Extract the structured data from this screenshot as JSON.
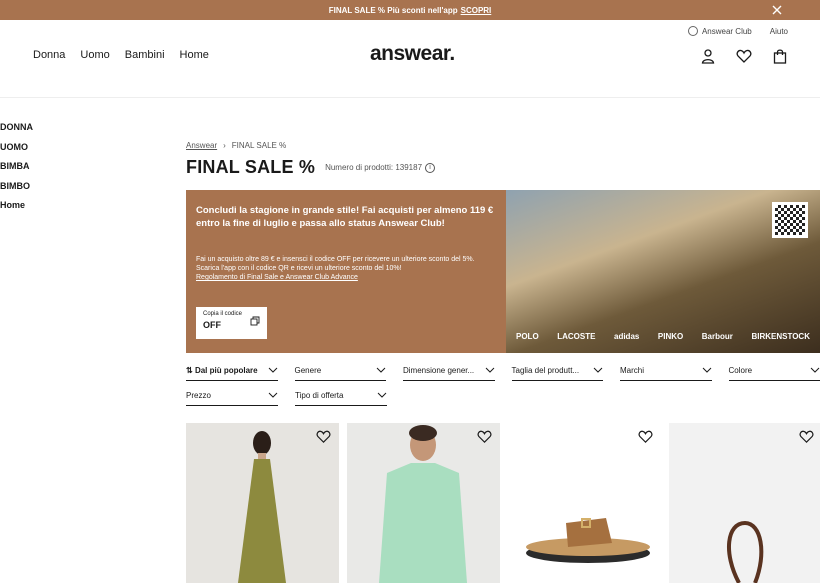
{
  "topbar": {
    "text": "FINAL SALE % Più sconti nell'app",
    "cta": "SCOPRI"
  },
  "header": {
    "util": {
      "club": "Answear Club",
      "help": "Aiuto"
    },
    "nav": [
      "Donna",
      "Uomo",
      "Bambini",
      "Home"
    ],
    "logo": "answear."
  },
  "sidebar": [
    "DONNA",
    "UOMO",
    "BIMBA",
    "BIMBO",
    "Home"
  ],
  "breadcrumb": {
    "home": "Answear",
    "sep": "›",
    "current": "FINAL SALE %"
  },
  "page": {
    "title": "FINAL SALE %",
    "count": "Numero di prodotti: 139187",
    "info": "i"
  },
  "banner": {
    "headline": "Concludi la stagione in grande stile! Fai acquisti per almeno 119 € entro la fine di luglio e passa allo status Answear Club!",
    "body": "Fai un acquisto oltre 89 € e insensci il codice OFF per ricevere un ulteriore sconto del 5%. Scarica l'app con il codice QR e ricevi un ulteriore sconto del 10%!",
    "rules": "Regolamento di Final Sale e Answear Club Advance",
    "code_label": "Copia il codice",
    "code": "OFF",
    "brands": [
      "POLO",
      "LACOSTE",
      "adidas",
      "PINKO",
      "Barbour",
      "BIRKENSTOCK"
    ]
  },
  "filters": {
    "row1": [
      "Dal più popolare",
      "Genere",
      "Dimensione gener...",
      "Taglia del produtt...",
      "Marchi",
      "Colore"
    ],
    "row2": [
      "Prezzo",
      "Tipo di offerta"
    ]
  },
  "products": [
    {
      "name": "olive-halter-dress",
      "bg": "#e6e4e0"
    },
    {
      "name": "mint-shirt",
      "bg": "#e9e9e7"
    },
    {
      "name": "tan-sandal",
      "bg": "#ffffff"
    },
    {
      "name": "brown-bag",
      "bg": "#f2f2f2"
    }
  ]
}
